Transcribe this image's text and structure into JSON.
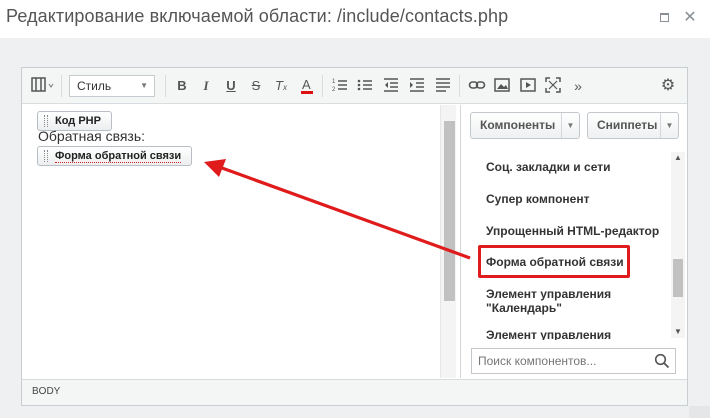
{
  "dialog": {
    "title": "Редактирование включаемой области: /include/contacts.php"
  },
  "toolbar": {
    "style_select": "Стиль",
    "buttons": [
      "source-icon",
      "bold-icon",
      "italic-icon",
      "underline-icon",
      "strikethrough-icon",
      "clear-format-icon",
      "font-color-icon",
      "ordered-list-icon",
      "unordered-list-icon",
      "outdent-icon",
      "indent-icon",
      "align-icon",
      "link-icon",
      "image-icon",
      "video-icon",
      "fullscreen-icon",
      "more-icon",
      "settings-icon"
    ]
  },
  "editor": {
    "chip_php": "Код PHP",
    "line_text": "Обратная связь:",
    "chip_form": "Форма обратной связи"
  },
  "sidebar": {
    "components_button": "Компоненты",
    "snippets_button": "Сниппеты",
    "items": [
      "Соц. закладки и сети",
      "Супер компонент",
      "Упрощенный HTML-редактор",
      "Форма обратной связи",
      "Элемент управления \"Календарь\"",
      "Элемент управления"
    ],
    "search_placeholder": "Поиск компонентов..."
  },
  "statusbar": {
    "path": "BODY"
  },
  "colors": {
    "highlight": "#e01b1b",
    "arrow": "#e01b1b"
  }
}
